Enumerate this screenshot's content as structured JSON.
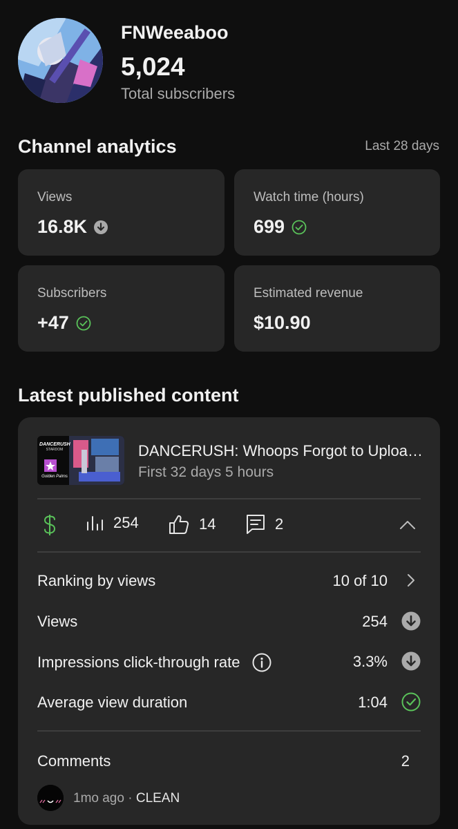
{
  "channel": {
    "name": "FNWeeaboo",
    "subscribers": "5,024",
    "subscribers_label": "Total subscribers"
  },
  "analytics": {
    "title": "Channel analytics",
    "period": "Last 28 days",
    "cards": [
      {
        "label": "Views",
        "value": "16.8K",
        "status_icon": "arrow-down-circle-icon"
      },
      {
        "label": "Watch time (hours)",
        "value": "699",
        "status_icon": "check-circle-icon"
      },
      {
        "label": "Subscribers",
        "value": "+47",
        "status_icon": "check-circle-icon"
      },
      {
        "label": "Estimated revenue",
        "value": "$10.90",
        "status_icon": ""
      }
    ]
  },
  "latest": {
    "title": "Latest published content",
    "video": {
      "title": "DANCERUSH: Whoops Forgot to Uploa…",
      "subtitle": "First 32 days 5 hours",
      "thumb_logo": "DANCERUSH",
      "thumb_logo_sub": "STARDOM",
      "thumb_caption": "Golden Palms"
    },
    "stats": {
      "views": "254",
      "likes": "14",
      "comments": "2"
    },
    "metrics": [
      {
        "label": "Ranking by views",
        "value": "10 of 10",
        "icon": "chevron-right-icon"
      },
      {
        "label": "Views",
        "value": "254",
        "icon": "arrow-down-circle-icon"
      },
      {
        "label": "Impressions click-through rate",
        "value": "3.3%",
        "icon": "arrow-down-circle-icon"
      },
      {
        "label": "Average view duration",
        "value": "1:04",
        "icon": "check-circle-icon"
      }
    ],
    "comments": {
      "label": "Comments",
      "count": "2",
      "latest_time": "1mo ago",
      "latest_text": "CLEAN"
    }
  },
  "colors": {
    "background": "#0f0f0f",
    "card": "#272727",
    "accent_green": "#5ac35a",
    "muted": "#aaaaaa"
  }
}
